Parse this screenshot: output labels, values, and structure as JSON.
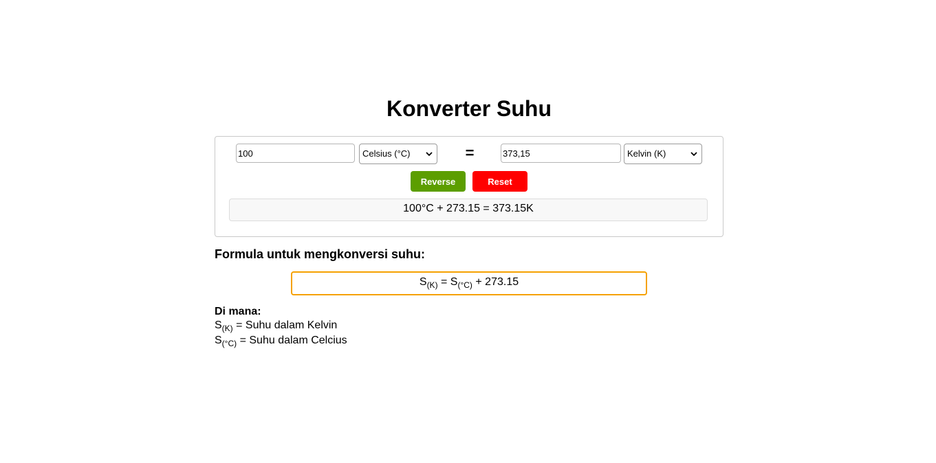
{
  "title": "Konverter Suhu",
  "converter": {
    "from_value": "100",
    "from_unit": "Celsius (°C)",
    "equals_sign": "=",
    "to_value": "373,15",
    "to_unit": "Kelvin (K)",
    "reverse_label": "Reverse",
    "reset_label": "Reset",
    "result_text": "100°C + 273.15 = 373.15K"
  },
  "formula": {
    "heading": "Formula untuk mengkonversi suhu:",
    "lhs_symbol": "S",
    "lhs_sub": "(K)",
    "equals": " = ",
    "rhs_symbol": "S",
    "rhs_sub": "(°C)",
    "rhs_rest": " + 273.15"
  },
  "where": {
    "heading": "Di mana:",
    "items": [
      {
        "symbol": "S",
        "sub": "(K)",
        "text": " = Suhu dalam Kelvin"
      },
      {
        "symbol": "S",
        "sub": "(°C)",
        "text": " = Suhu dalam Celcius"
      }
    ]
  },
  "colors": {
    "reverse_button": "#5c9e00",
    "reset_button": "#ff0000",
    "formula_border": "#f5a100"
  },
  "icons": {
    "select_arrow": "chevron-down-icon"
  }
}
